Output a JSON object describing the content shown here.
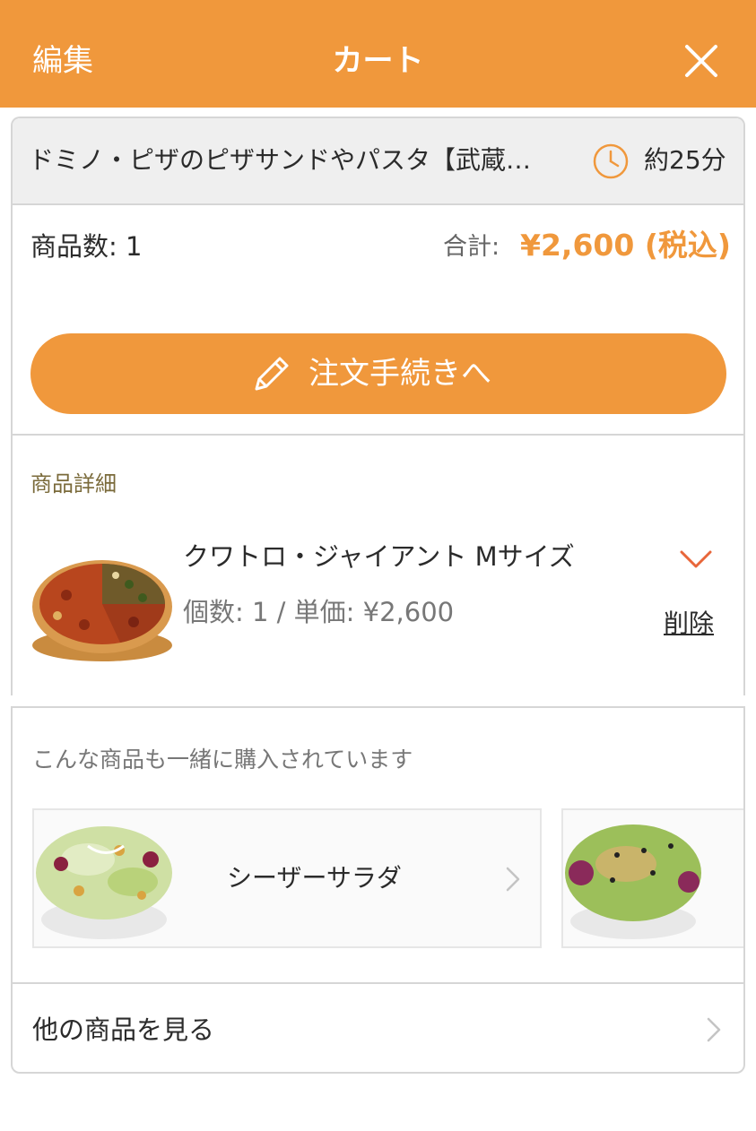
{
  "header": {
    "edit_label": "編集",
    "title": "カート",
    "close_icon": "close-icon",
    "background": "#F0983C"
  },
  "shop": {
    "name": "ドミノ・ピザのピザサンドやパスタ【武蔵…",
    "eta": "約25分",
    "clock_icon": "clock-icon"
  },
  "summary": {
    "count_label": "商品数: 1",
    "total_label": "合計:",
    "total_value": "¥2,600 (税込)",
    "accent_color": "#F0983C"
  },
  "order_button": {
    "label": "注文手続きへ",
    "icon": "pencil-icon"
  },
  "details": {
    "title": "商品詳細",
    "items": [
      {
        "name": "クワトロ・ジャイアント Mサイズ",
        "meta": "個数: 1 / 単価: ¥2,600",
        "expand_icon": "chevron-down-icon",
        "delete_label": "削除",
        "image": "pizza-image"
      }
    ]
  },
  "recommendations": {
    "title": "こんな商品も一緒に購入されています",
    "items": [
      {
        "name": "シーザーサラダ",
        "image": "caesar-salad-image",
        "icon": "chevron-right-icon"
      },
      {
        "name": "",
        "image": "salad-image",
        "icon": ""
      }
    ]
  },
  "more": {
    "label": "他の商品を見る",
    "icon": "chevron-right-icon"
  }
}
